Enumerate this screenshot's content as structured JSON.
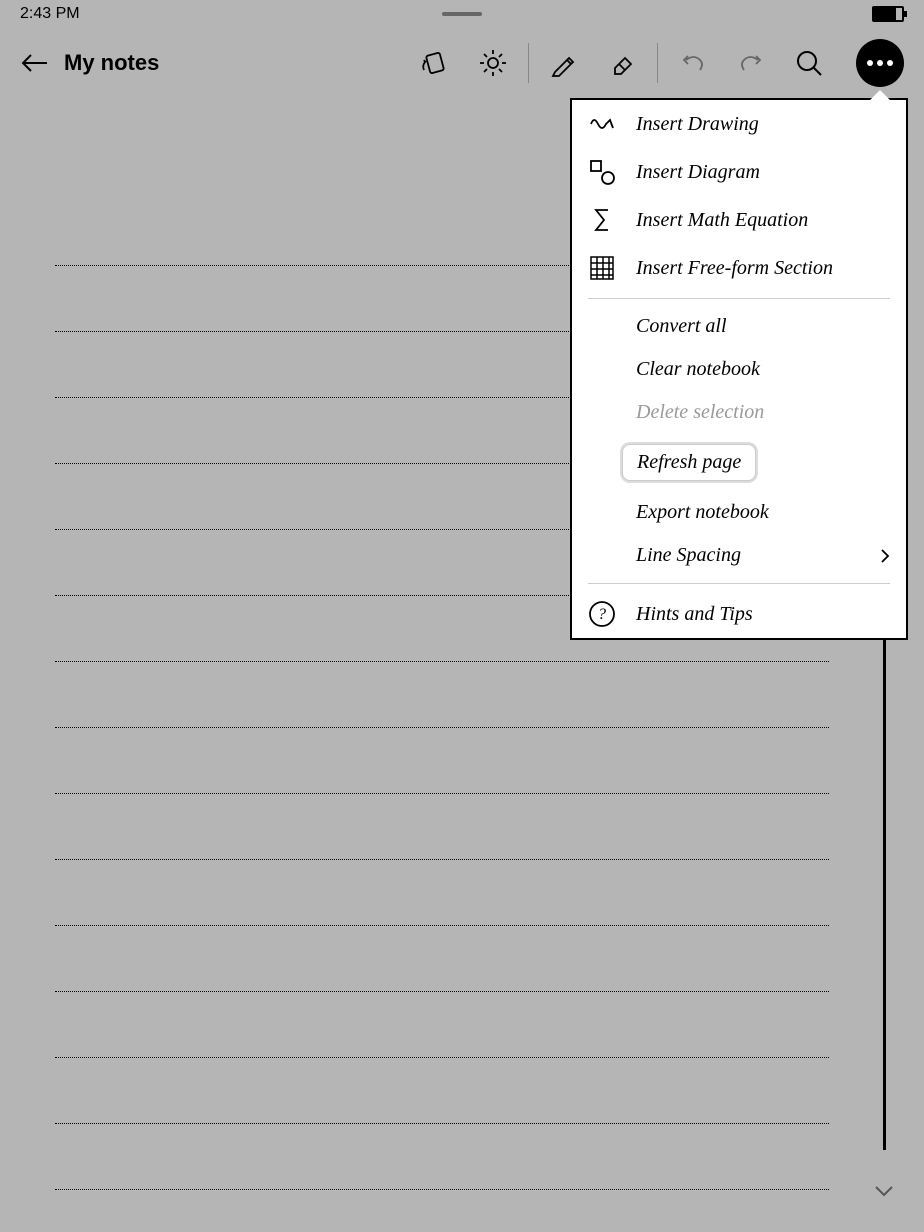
{
  "status": {
    "time": "2:43 PM"
  },
  "header": {
    "title": "My notes"
  },
  "menu": {
    "insert_drawing": "Insert Drawing",
    "insert_diagram": "Insert Diagram",
    "insert_math": "Insert Math Equation",
    "insert_freeform": "Insert Free-form Section",
    "convert_all": "Convert all",
    "clear_notebook": "Clear notebook",
    "delete_selection": "Delete selection",
    "refresh_page": "Refresh page",
    "export_notebook": "Export notebook",
    "line_spacing": "Line Spacing",
    "hints_tips": "Hints and Tips"
  }
}
